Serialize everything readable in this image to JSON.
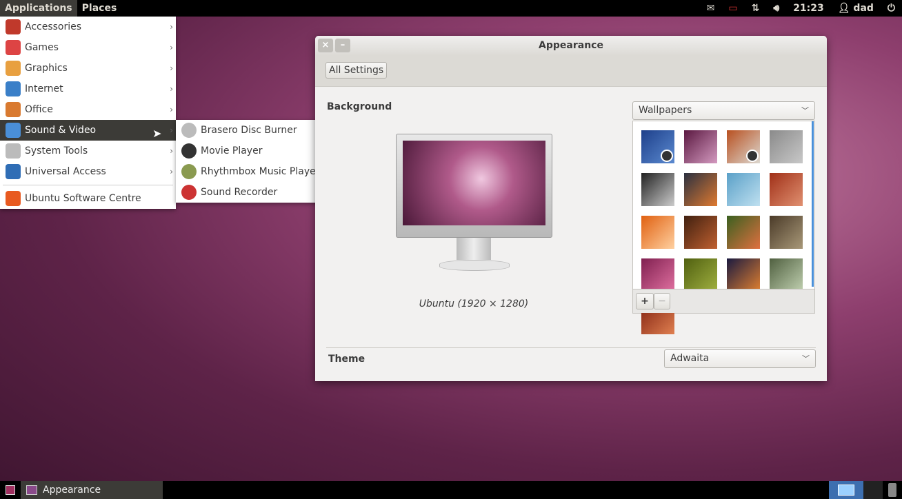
{
  "topbar": {
    "applications": "Applications",
    "places": "Places",
    "clock": "21:23",
    "user": "dad",
    "icons": [
      "mail-icon",
      "battery-icon",
      "network-icon",
      "volume-icon",
      "user-icon",
      "power-icon"
    ]
  },
  "app_menu": {
    "items": [
      {
        "label": "Accessories",
        "icon": "accessories-icon",
        "color": "#c0392b"
      },
      {
        "label": "Games",
        "icon": "games-icon",
        "color": "#d44"
      },
      {
        "label": "Graphics",
        "icon": "graphics-icon",
        "color": "#e8a040"
      },
      {
        "label": "Internet",
        "icon": "internet-icon",
        "color": "#3a7fc8"
      },
      {
        "label": "Office",
        "icon": "office-icon",
        "color": "#d97a30"
      },
      {
        "label": "Sound & Video",
        "icon": "sound-video-icon",
        "color": "#4a8fd8"
      },
      {
        "label": "System Tools",
        "icon": "system-tools-icon",
        "color": "#bbb"
      },
      {
        "label": "Universal Access",
        "icon": "universal-access-icon",
        "color": "#2f6db5"
      }
    ],
    "software_centre": "Ubuntu Software Centre"
  },
  "submenu": {
    "items": [
      {
        "label": "Brasero Disc Burner",
        "icon": "disc-icon",
        "color": "#bbb"
      },
      {
        "label": "Movie Player",
        "icon": "clapper-icon",
        "color": "#333"
      },
      {
        "label": "Rhythmbox Music Player",
        "icon": "rhythmbox-icon",
        "color": "#8a9a50"
      },
      {
        "label": "Sound Recorder",
        "icon": "microphone-icon",
        "color": "#c33"
      }
    ]
  },
  "window": {
    "title": "Appearance",
    "all_settings": "All Settings",
    "background_label": "Background",
    "wallpaper_caption": "Ubuntu (1920 × 1280)",
    "source_select": "Wallpapers",
    "theme_label": "Theme",
    "theme_select": "Adwaita",
    "add": "+",
    "remove": "−"
  },
  "wallpapers": [
    {
      "colors": [
        "#1d3f8a",
        "#5b8ad0"
      ],
      "slideshow": true
    },
    {
      "colors": [
        "#5a1840",
        "#d49ac0"
      ]
    },
    {
      "colors": [
        "#b85020",
        "#dcd8d0"
      ],
      "slideshow": true
    },
    {
      "colors": [
        "#8a8a8a",
        "#c8c8c8"
      ]
    },
    {
      "colors": [
        "#222",
        "#ccc"
      ]
    },
    {
      "colors": [
        "#2a3040",
        "#e07a30"
      ]
    },
    {
      "colors": [
        "#5aa0c8",
        "#bfe0f0"
      ]
    },
    {
      "colors": [
        "#a03018",
        "#e09070"
      ]
    },
    {
      "colors": [
        "#e06010",
        "#ffd0a0"
      ]
    },
    {
      "colors": [
        "#402010",
        "#c06030"
      ]
    },
    {
      "colors": [
        "#3a6020",
        "#e07040"
      ]
    },
    {
      "colors": [
        "#4a3a28",
        "#a89878"
      ]
    },
    {
      "colors": [
        "#802050",
        "#e070a0"
      ]
    },
    {
      "colors": [
        "#506010",
        "#a0b040"
      ]
    },
    {
      "colors": [
        "#1a1a40",
        "#e08030"
      ]
    },
    {
      "colors": [
        "#506040",
        "#c0d0b0"
      ]
    },
    {
      "colors": [
        "#802010",
        "#e08050"
      ]
    }
  ],
  "taskbar": {
    "task": "Appearance"
  }
}
